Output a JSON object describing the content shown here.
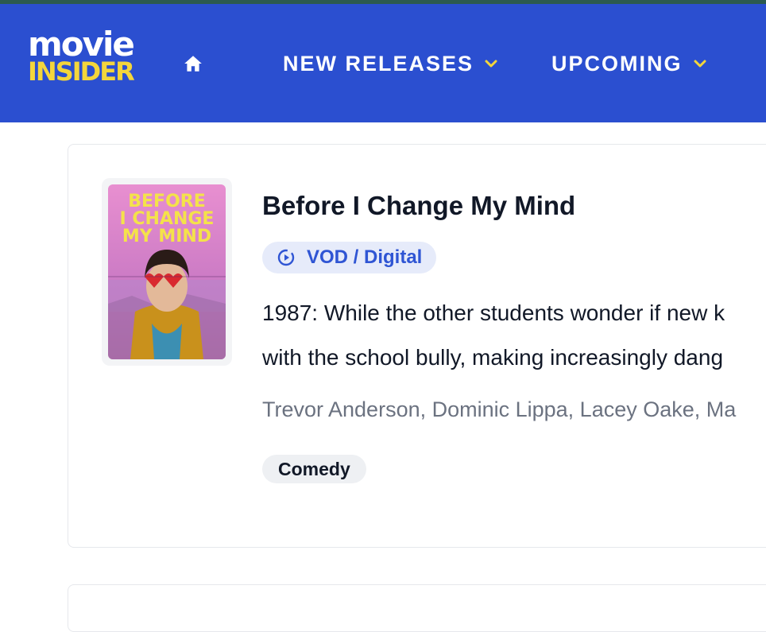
{
  "brand": {
    "logo_top": "movie",
    "logo_bottom": "INSIDER",
    "colors": {
      "nav_bg": "#2b4fd0",
      "logo_yellow": "#f4d63b",
      "accent_blue": "#2f55d4"
    }
  },
  "nav": {
    "home_icon": "home-icon",
    "items": [
      {
        "label": "NEW RELEASES",
        "icon": "chevron-down-icon"
      },
      {
        "label": "UPCOMING",
        "icon": "chevron-down-icon"
      }
    ]
  },
  "movie": {
    "poster_text": [
      "BEFORE",
      "I CHANGE",
      "MY MIND"
    ],
    "title": "Before I Change My Mind",
    "release_badge": {
      "icon": "play-circle-icon",
      "label": "VOD / Digital"
    },
    "description_lines": [
      "1987: While the other students wonder if new k",
      "with the school bully, making increasingly dang"
    ],
    "cast": "Trevor Anderson, Dominic Lippa, Lacey Oake, Ma",
    "genres": [
      "Comedy"
    ]
  }
}
